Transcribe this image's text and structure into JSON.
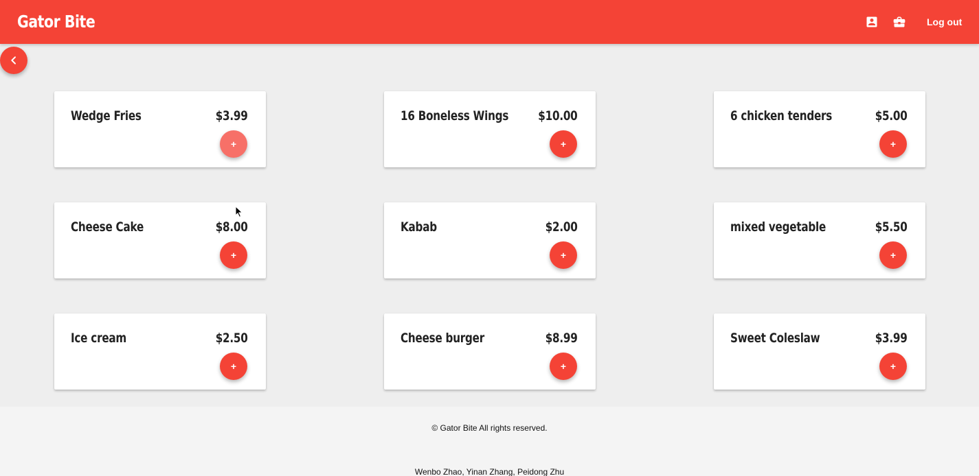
{
  "header": {
    "brand": "Gator Bite",
    "profile_icon": "account-box-icon",
    "orders_icon": "briefcase-icon",
    "logout_label": "Log out"
  },
  "back_icon": "chevron-left-icon",
  "menu_items": [
    {
      "name": "Wedge Fries",
      "price": "$3.99",
      "add_label": "+"
    },
    {
      "name": "16 Boneless Wings",
      "price": "$10.00",
      "add_label": "+"
    },
    {
      "name": "6 chicken tenders",
      "price": "$5.00",
      "add_label": "+"
    },
    {
      "name": "Cheese Cake",
      "price": "$8.00",
      "add_label": "+"
    },
    {
      "name": "Kabab",
      "price": "$2.00",
      "add_label": "+"
    },
    {
      "name": "mixed vegetable",
      "price": "$5.50",
      "add_label": "+"
    },
    {
      "name": "Ice cream",
      "price": "$2.50",
      "add_label": "+"
    },
    {
      "name": "Cheese burger",
      "price": "$8.99",
      "add_label": "+"
    },
    {
      "name": "Sweet Coleslaw",
      "price": "$3.99",
      "add_label": "+"
    }
  ],
  "footer": {
    "copyright": "© Gator Bite All rights reserved.",
    "authors": "Wenbo Zhao, Yinan Zhang, Peidong Zhu"
  },
  "colors": {
    "primary": "#f44336",
    "primary_hover": "#f77068",
    "background": "#eeeeee",
    "footer_bg": "#f4f4f4"
  }
}
